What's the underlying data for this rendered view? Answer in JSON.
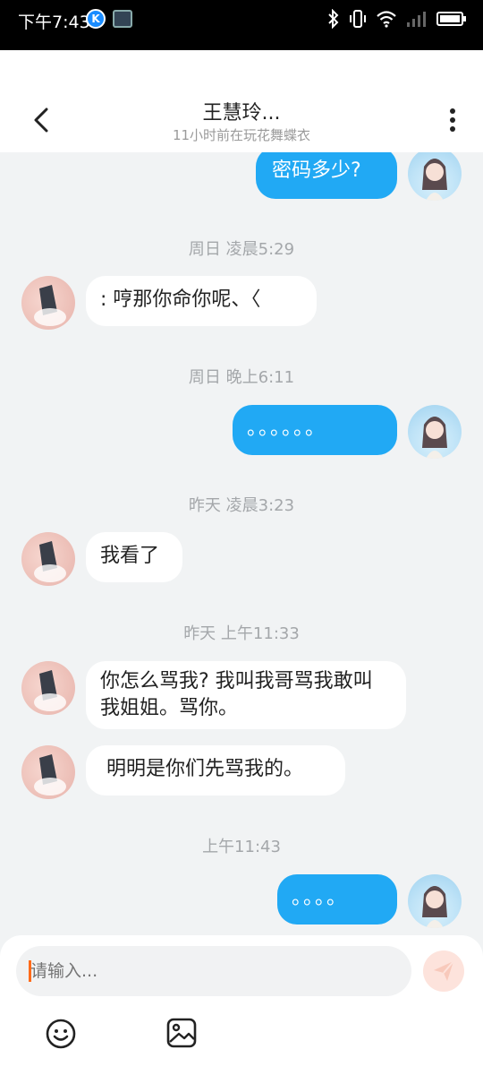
{
  "status_bar": {
    "time": "下午7:43",
    "app_icon_1_letter": "K"
  },
  "header": {
    "title": "王慧玲...",
    "subtitle": "11小时前在玩花舞蝶衣"
  },
  "messages": [
    {
      "dir": "out",
      "text": "密码多少?"
    },
    {
      "type": "timestamp",
      "text": "周日 凌晨5:29"
    },
    {
      "dir": "in",
      "text": ":  哼那你命你呢、〈"
    },
    {
      "type": "timestamp",
      "text": "周日 晚上6:11"
    },
    {
      "dir": "out",
      "text": "。。。。。。"
    },
    {
      "type": "timestamp",
      "text": "昨天 凌晨3:23"
    },
    {
      "dir": "in",
      "text": "我看了"
    },
    {
      "type": "timestamp",
      "text": "昨天 上午11:33"
    },
    {
      "dir": "in",
      "text": "你怎么骂我? 我叫我哥骂我敢叫我姐姐。骂你。"
    },
    {
      "dir": "in",
      "text": " 明明是你们先骂我的。"
    },
    {
      "type": "timestamp",
      "text": "上午11:43"
    },
    {
      "dir": "out",
      "text": "。。。。"
    }
  ],
  "input": {
    "placeholder": "请输入..."
  },
  "colors": {
    "outgoing_bubble": "#21a9f4",
    "incoming_bubble": "#ffffff",
    "chat_background": "#f1f3f4",
    "send_button": "#fde3dc",
    "timestamp_text": "#a4a7aa"
  },
  "icons": {
    "back": "chevron-left-icon",
    "more": "more-vertical-icon",
    "send": "paper-plane-icon",
    "emoji": "smiley-icon",
    "image": "image-icon"
  }
}
